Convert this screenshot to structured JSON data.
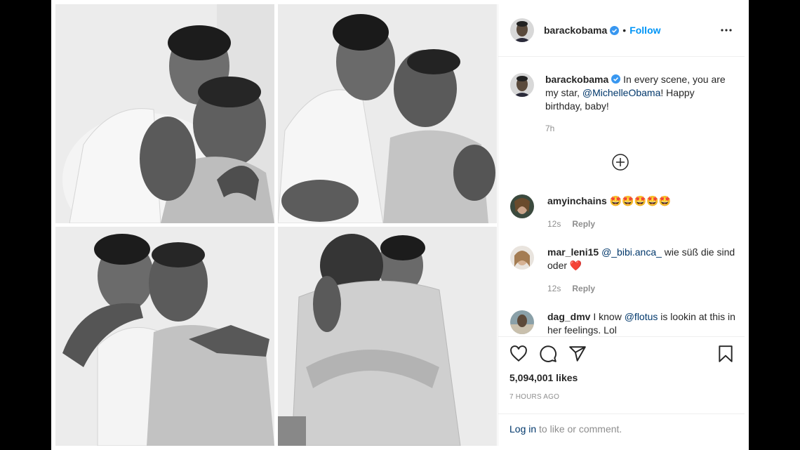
{
  "post": {
    "author": "barackobama",
    "follow_label": "Follow",
    "separator": "•",
    "caption_text": "In every scene, you are my star,",
    "caption_mention": "@MichelleObama",
    "caption_tail": "! Happy birthday, baby!",
    "caption_time": "7h"
  },
  "comments": [
    {
      "user": "amyinchains",
      "text": "🤩🤩🤩🤩🤩",
      "time": "12s",
      "reply": "Reply"
    },
    {
      "user": "mar_leni15",
      "mention": "@_bibi.anca_",
      "text": " wie süß die sind oder ",
      "emoji": "❤️",
      "time": "12s",
      "reply": "Reply"
    },
    {
      "user": "dag_dmv",
      "pre": "I know ",
      "mention": "@flotus",
      "text": " is lookin at this in her feelings. Lol"
    }
  ],
  "stats": {
    "likes": "5,094,001 likes",
    "posted": "7 HOURS AGO"
  },
  "login": {
    "link": "Log in",
    "rest": " to like or comment."
  },
  "icons": [
    "more-icon",
    "verified-badge-icon",
    "add-comment-icon",
    "heart-icon",
    "comment-icon",
    "share-icon",
    "bookmark-icon"
  ],
  "colors": {
    "link": "#0095f6",
    "mention": "#00376b",
    "muted": "#8e8e8e",
    "verified": "#3897f0"
  }
}
